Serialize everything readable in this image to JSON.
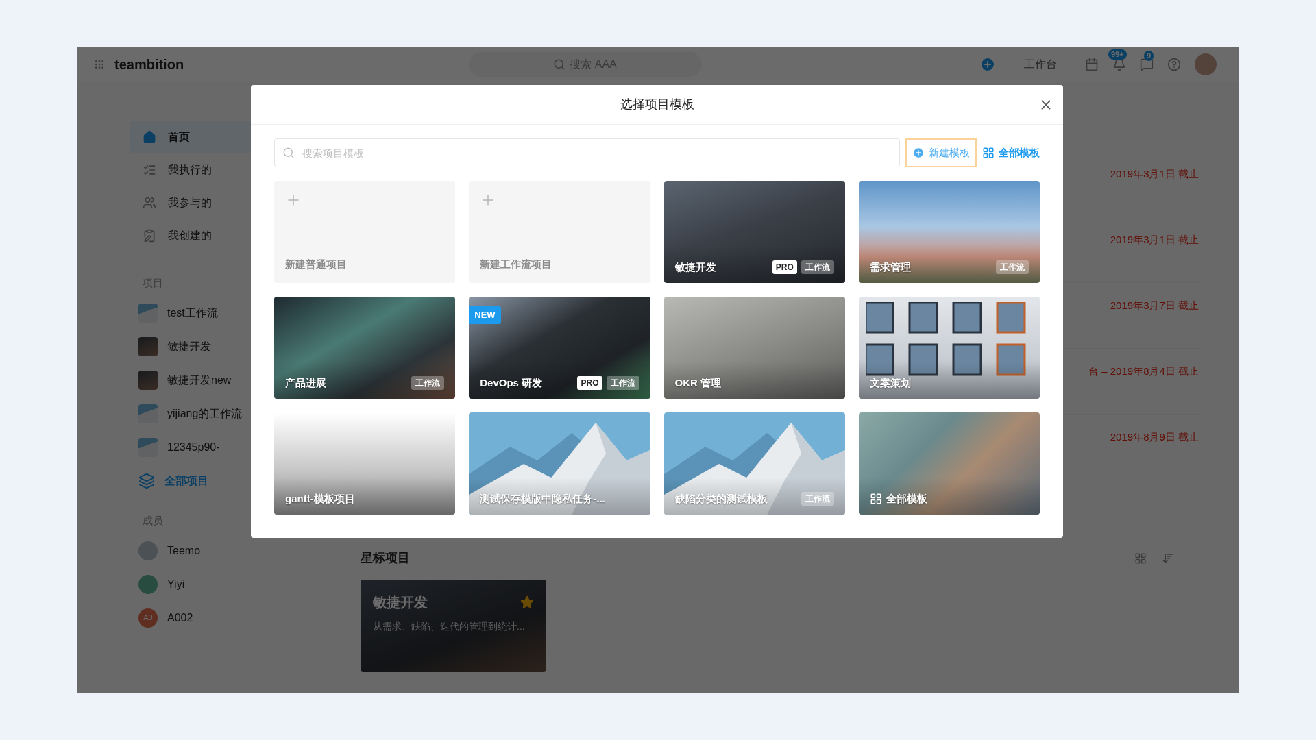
{
  "topbar": {
    "logo": "teambition",
    "search_placeholder": "搜索 AAA",
    "workbench": "工作台",
    "notification_count": "99+",
    "message_count": "9"
  },
  "sidebar": {
    "nav": [
      {
        "label": "首页",
        "selected": true
      },
      {
        "label": "我执行的",
        "selected": false
      },
      {
        "label": "我参与的",
        "selected": false
      },
      {
        "label": "我创建的",
        "selected": false
      }
    ],
    "projects_heading": "项目",
    "projects": [
      {
        "name": "test工作流"
      },
      {
        "name": "敏捷开发"
      },
      {
        "name": "敏捷开发new"
      },
      {
        "name": "yijiang的工作流"
      },
      {
        "name": "12345p90-"
      }
    ],
    "all_projects": "全部项目",
    "members_heading": "成员",
    "members": [
      {
        "name": "Teemo"
      },
      {
        "name": "Yiyi"
      },
      {
        "name": "A002",
        "initials": "A0"
      }
    ]
  },
  "due_dates": [
    "2019年3月1日 截止",
    "2019年3月1日 截止",
    "2019年3月7日 截止",
    "台 – 2019年8月4日 截止",
    "2019年8月9日 截止"
  ],
  "starred": {
    "heading": "星标项目",
    "card": {
      "title": "敏捷开发",
      "description": "从需求、缺陷、迭代的管理到统计...",
      "starred": true
    }
  },
  "modal": {
    "title": "选择项目模板",
    "search_placeholder": "搜索项目模板",
    "new_template": {
      "label": "新建模板",
      "focused": true
    },
    "all_templates": "全部模板",
    "templates": [
      {
        "kind": "blank",
        "title": "新建普通项目"
      },
      {
        "kind": "blank",
        "title": "新建工作流项目"
      },
      {
        "kind": "photo",
        "title": "敏捷开发",
        "pro": "PRO",
        "workflow": "工作流"
      },
      {
        "kind": "photo",
        "title": "需求管理",
        "workflow": "工作流"
      },
      {
        "kind": "photo",
        "title": "产品进展",
        "workflow": "工作流"
      },
      {
        "kind": "photo",
        "title": "DevOps 研发",
        "new": "NEW",
        "pro": "PRO",
        "workflow": "工作流"
      },
      {
        "kind": "photo",
        "title": "OKR 管理"
      },
      {
        "kind": "photo",
        "title": "文案策划"
      },
      {
        "kind": "photo",
        "title": "gantt-模板项目"
      },
      {
        "kind": "photo",
        "title": "测试保存模版中隐私任务-..."
      },
      {
        "kind": "photo",
        "title": "缺陷分类的测试模板",
        "workflow": "工作流"
      },
      {
        "kind": "all",
        "title": "全部模板"
      }
    ]
  }
}
